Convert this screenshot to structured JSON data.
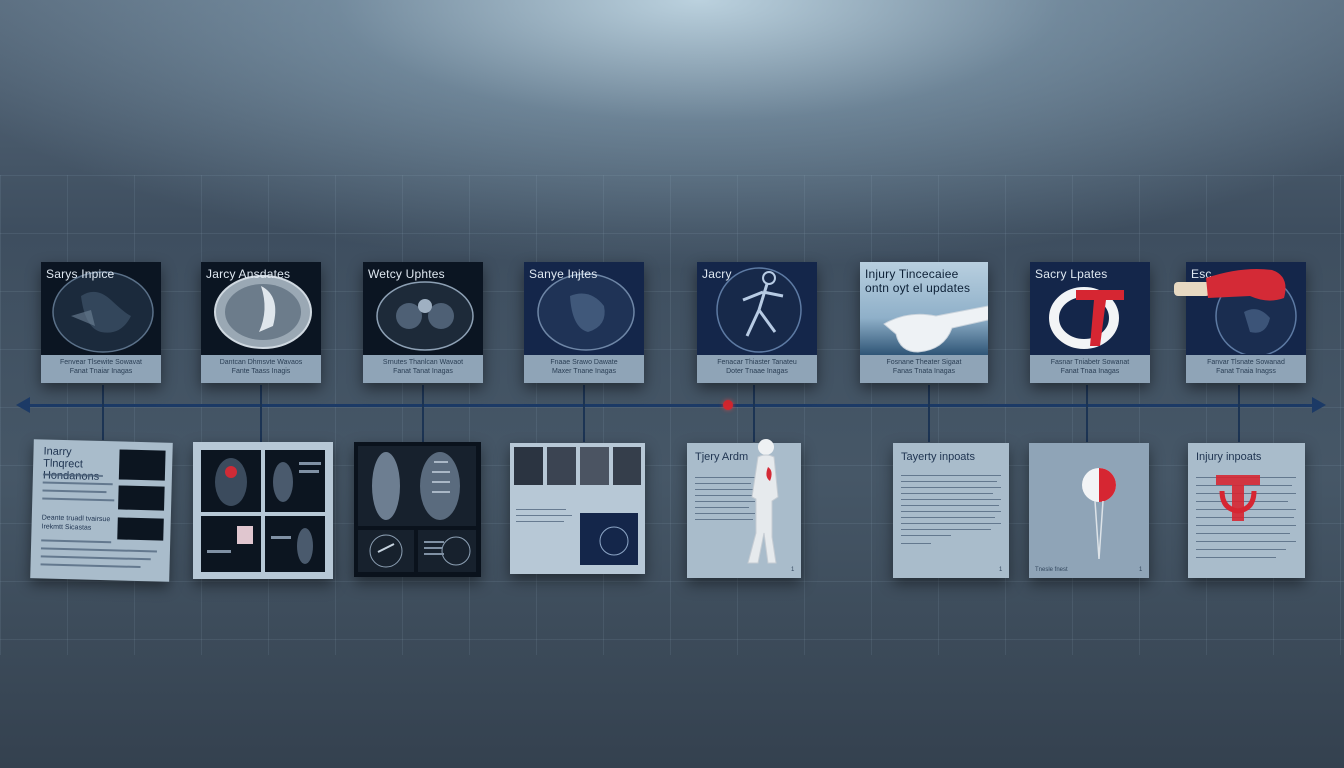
{
  "top_cards": [
    {
      "title": "Sarys Inpice",
      "caption_1": "Fenvear Tlsewite Sowavat",
      "caption_2": "Fanat Tnaiar Inagas"
    },
    {
      "title": "Jarcy Ansdates",
      "caption_1": "Dantcan Dhmsvte Wavaos",
      "caption_2": "Fante Taass Inagis"
    },
    {
      "title": "Wetcy Uphtes",
      "caption_1": "Srnutes Thanlcan Wavaot",
      "caption_2": "Fanat Tanat Inagas"
    },
    {
      "title": "Sanye Injtes",
      "caption_1": "Fnaae Srawo Dawate",
      "caption_2": "Maxer Tnane Inagas"
    },
    {
      "title": "Jacry",
      "caption_1": "Fenacar Thiaster Tanateu",
      "caption_2": "Doter Tnaae Inagas"
    },
    {
      "title": "Injury Tincecaiee ontn oyt el updates",
      "caption_1": "Fosnane Theater Sigaat",
      "caption_2": "Fanas Tnata Inagas"
    },
    {
      "title": "Sacry Lpates",
      "caption_1": "Fasnar Tniabetr Sowanat",
      "caption_2": "Fanat Tnaa Inagas"
    },
    {
      "title": "Esc",
      "caption_1": "Fanvar Tlsnate Sowanad",
      "caption_2": "Fanat Tnaia Inagss"
    }
  ],
  "bottom_cards": [
    {
      "title": "Inarry Tlnqrect Hondanons",
      "subhead": "Deante truadl tvairsue Irekmtt Sicastas",
      "page": ""
    },
    {
      "title": "",
      "subhead": "",
      "page": ""
    },
    {
      "title": "",
      "subhead": "",
      "page": ""
    },
    {
      "title": "",
      "subhead": "",
      "page": ""
    },
    {
      "title": "Tjery Ardm",
      "subhead": "",
      "page": "1"
    },
    {
      "title": "Tayerty inpoats",
      "subhead": "",
      "page": "1"
    },
    {
      "title": "Tnesle fnest",
      "subhead": "",
      "page": "1"
    },
    {
      "title": "Injury inpoats",
      "subhead": "",
      "page": ""
    }
  ],
  "colors": {
    "axis": "#1c3a66",
    "marker": "#d2262e",
    "accent_red": "#d62632"
  }
}
